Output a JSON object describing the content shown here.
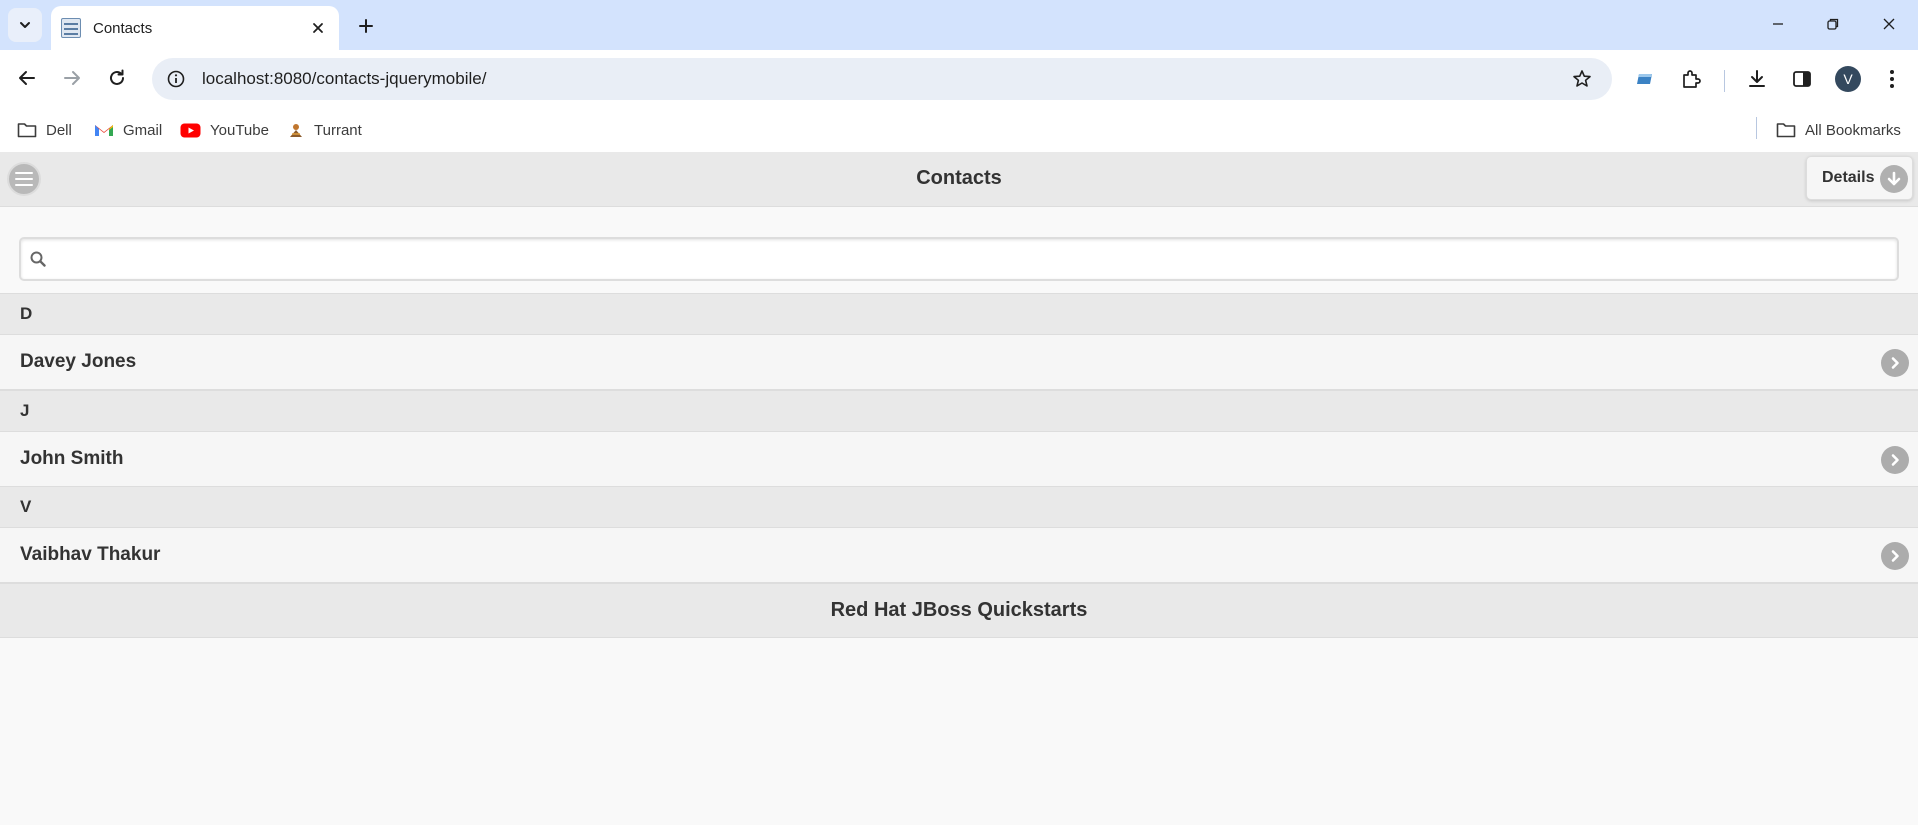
{
  "browser": {
    "tab": {
      "title": "Contacts"
    },
    "url": "localhost:8080/contacts-jquerymobile/",
    "profile_initial": "V",
    "bookmarks": [
      {
        "label": "Dell",
        "icon": "folder-icon"
      },
      {
        "label": "Gmail",
        "icon": "gmail-icon"
      },
      {
        "label": "YouTube",
        "icon": "youtube-icon"
      },
      {
        "label": "Turrant",
        "icon": "turrant-icon"
      }
    ],
    "all_bookmarks_label": "All Bookmarks"
  },
  "header": {
    "title": "Contacts",
    "details_label": "Details"
  },
  "search": {
    "value": "",
    "placeholder": ""
  },
  "contacts": [
    {
      "divider": "D",
      "name": "Davey Jones"
    },
    {
      "divider": "J",
      "name": "John Smith"
    },
    {
      "divider": "V",
      "name": "Vaibhav Thakur"
    }
  ],
  "footer": {
    "text": "Red Hat JBoss Quickstarts"
  },
  "colors": {
    "tabstrip_bg": "#d3e3fd",
    "omnibox_bg": "#e9eef6",
    "bar_bg": "#e9e9e9",
    "list_bg": "#f6f6f6",
    "icon_gray": "#acacac"
  }
}
